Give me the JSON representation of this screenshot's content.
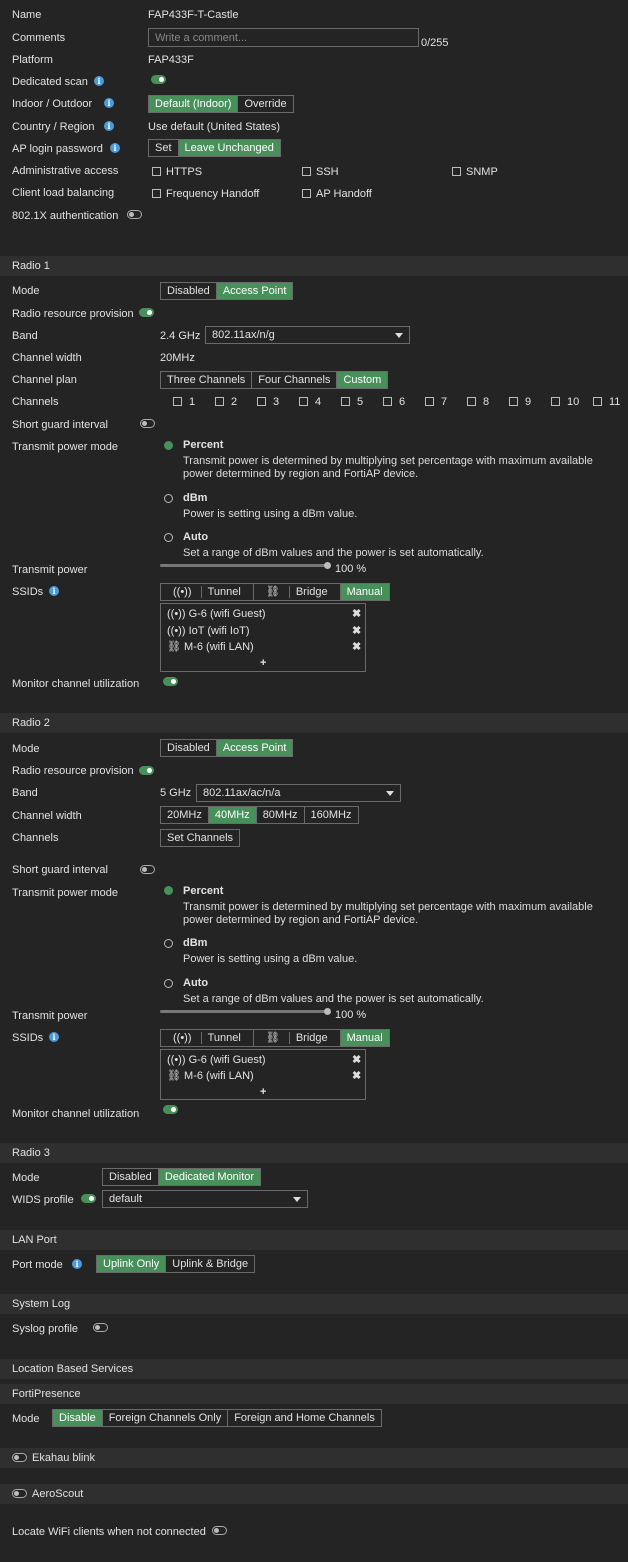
{
  "general": {
    "name_label": "Name",
    "name_value": "FAP433F-T-Castle",
    "comments_label": "Comments",
    "comments_placeholder": "Write a comment...",
    "comments_count": "0/255",
    "platform_label": "Platform",
    "platform_value": "FAP433F",
    "dedicated_scan_label": "Dedicated scan",
    "indoor_label": "Indoor / Outdoor",
    "indoor_opt1": "Default (Indoor)",
    "indoor_opt2": "Override",
    "country_label": "Country / Region",
    "country_value": "Use default (United States)",
    "ap_login_label": "AP login password",
    "ap_login_opt1": "Set",
    "ap_login_opt2": "Leave Unchanged",
    "admin_access_label": "Administrative access",
    "https": "HTTPS",
    "ssh": "SSH",
    "snmp": "SNMP",
    "client_lb_label": "Client load balancing",
    "freq_handoff": "Frequency Handoff",
    "ap_handoff": "AP Handoff",
    "dot1x_label": "802.1X authentication"
  },
  "radio1": {
    "header": "Radio 1",
    "mode_label": "Mode",
    "mode_opt1": "Disabled",
    "mode_opt2": "Access Point",
    "rrp_label": "Radio resource provision",
    "band_label": "Band",
    "band_prefix": "2.4 GHz",
    "band_value": "802.11ax/n/g",
    "cw_label": "Channel width",
    "cw_value": "20MHz",
    "cp_label": "Channel plan",
    "cp_opt1": "Three Channels",
    "cp_opt2": "Four Channels",
    "cp_opt3": "Custom",
    "channels_label": "Channels",
    "channels": [
      "1",
      "2",
      "3",
      "4",
      "5",
      "6",
      "7",
      "8",
      "9",
      "10",
      "11"
    ],
    "sgi_label": "Short guard interval",
    "tpm_label": "Transmit power mode",
    "percent_title": "Percent",
    "percent_desc1": "Transmit power is determined by multiplying set percentage with maximum available",
    "percent_desc2": "power determined by region and FortiAP device.",
    "dbm_title": "dBm",
    "dbm_desc": "Power is setting using a dBm value.",
    "auto_title": "Auto",
    "auto_desc": "Set a range of dBm values and the power is set automatically.",
    "tp_label": "Transmit power",
    "tp_value": "100 %",
    "tp_fraction": 1.0,
    "ssids_label": "SSIDs",
    "ssid_opt1": "Tunnel",
    "ssid_opt2": "Bridge",
    "ssid_opt3": "Manual",
    "ssid1": "G-6 (wifi Guest)",
    "ssid2": "IoT (wifi IoT)",
    "ssid3": "M-6 (wifi LAN)",
    "add": "+",
    "mcu_label": "Monitor channel utilization"
  },
  "radio2": {
    "header": "Radio 2",
    "mode_label": "Mode",
    "mode_opt1": "Disabled",
    "mode_opt2": "Access Point",
    "rrp_label": "Radio resource provision",
    "band_label": "Band",
    "band_prefix": "5 GHz",
    "band_value": "802.11ax/ac/n/a",
    "cw_label": "Channel width",
    "cw_opt1": "20MHz",
    "cw_opt2": "40MHz",
    "cw_opt3": "80MHz",
    "cw_opt4": "160MHz",
    "channels_label": "Channels",
    "set_channels": "Set Channels",
    "sgi_label": "Short guard interval",
    "tpm_label": "Transmit power mode",
    "percent_title": "Percent",
    "percent_desc1": "Transmit power is determined by multiplying set percentage with maximum available",
    "percent_desc2": "power determined by region and FortiAP device.",
    "dbm_title": "dBm",
    "dbm_desc": "Power is setting using a dBm value.",
    "auto_title": "Auto",
    "auto_desc": "Set a range of dBm values and the power is set automatically.",
    "tp_label": "Transmit power",
    "tp_value": "100 %",
    "tp_fraction": 1.0,
    "ssids_label": "SSIDs",
    "ssid_opt1": "Tunnel",
    "ssid_opt2": "Bridge",
    "ssid_opt3": "Manual",
    "ssid1": "G-6 (wifi Guest)",
    "ssid2": "M-6 (wifi LAN)",
    "add": "+",
    "mcu_label": "Monitor channel utilization"
  },
  "radio3": {
    "header": "Radio 3",
    "mode_label": "Mode",
    "mode_opt1": "Disabled",
    "mode_opt2": "Dedicated Monitor",
    "wids_label": "WIDS profile",
    "wids_value": "default"
  },
  "lan": {
    "header": "LAN Port",
    "port_mode_label": "Port mode",
    "opt1": "Uplink Only",
    "opt2": "Uplink & Bridge"
  },
  "syslog": {
    "header": "System Log",
    "profile_label": "Syslog profile"
  },
  "lbs": {
    "header": "Location Based Services",
    "fp_header": "FortiPresence",
    "mode_label": "Mode",
    "opt1": "Disable",
    "opt2": "Foreign Channels Only",
    "opt3": "Foreign and Home Channels",
    "ekahau": "Ekahau blink",
    "aeroscout": "AeroScout",
    "locate": "Locate WiFi clients when not connected"
  },
  "colors": {
    "accent": "#47905a",
    "info": "#4a9bdd",
    "background": "#242424",
    "header": "#2f2f2f"
  }
}
